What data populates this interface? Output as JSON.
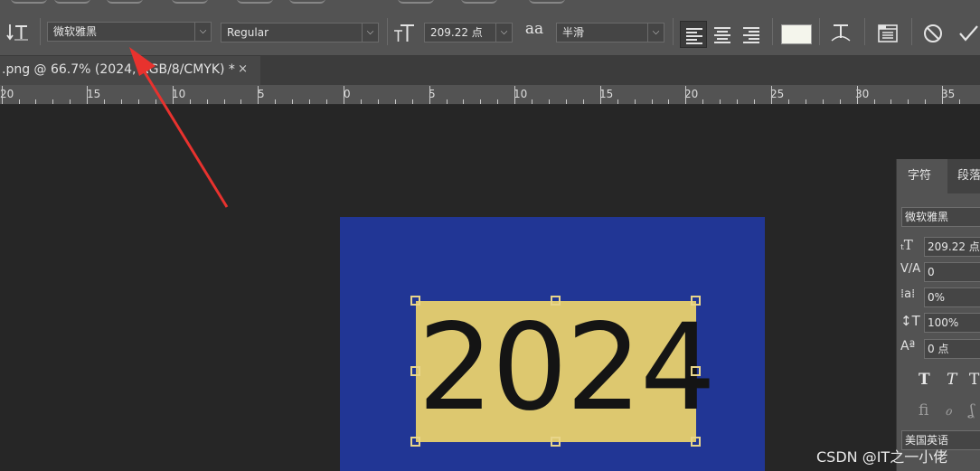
{
  "options_bar": {
    "font_family": "微软雅黑",
    "font_style": "Regular",
    "font_size": "209.22 点",
    "antialias_icon": "aa",
    "antialias": "半滑",
    "chevron": "⌵"
  },
  "tab": {
    "title": ".png @ 66.7% (2024, RGB/8/CMYK) *",
    "close": "×"
  },
  "ruler": {
    "labels": [
      "20",
      "15",
      "10",
      "5",
      "0",
      "5",
      "10",
      "15",
      "20",
      "25",
      "30",
      "35"
    ]
  },
  "canvas": {
    "text": "2024",
    "document_color": "#213695",
    "text_highlight_color": "#ddc86f"
  },
  "character_panel": {
    "tab_character": "字符",
    "tab_paragraph": "段落",
    "font_family": "微软雅黑",
    "font_size": "209.22 点",
    "kerning": "0",
    "tracking": "0%",
    "vertical_scale": "100%",
    "baseline_shift": "0 点",
    "language": "美国英语"
  },
  "watermark": "CSDN @IT之一小佬",
  "annotation": {
    "color": "#e8322e"
  }
}
